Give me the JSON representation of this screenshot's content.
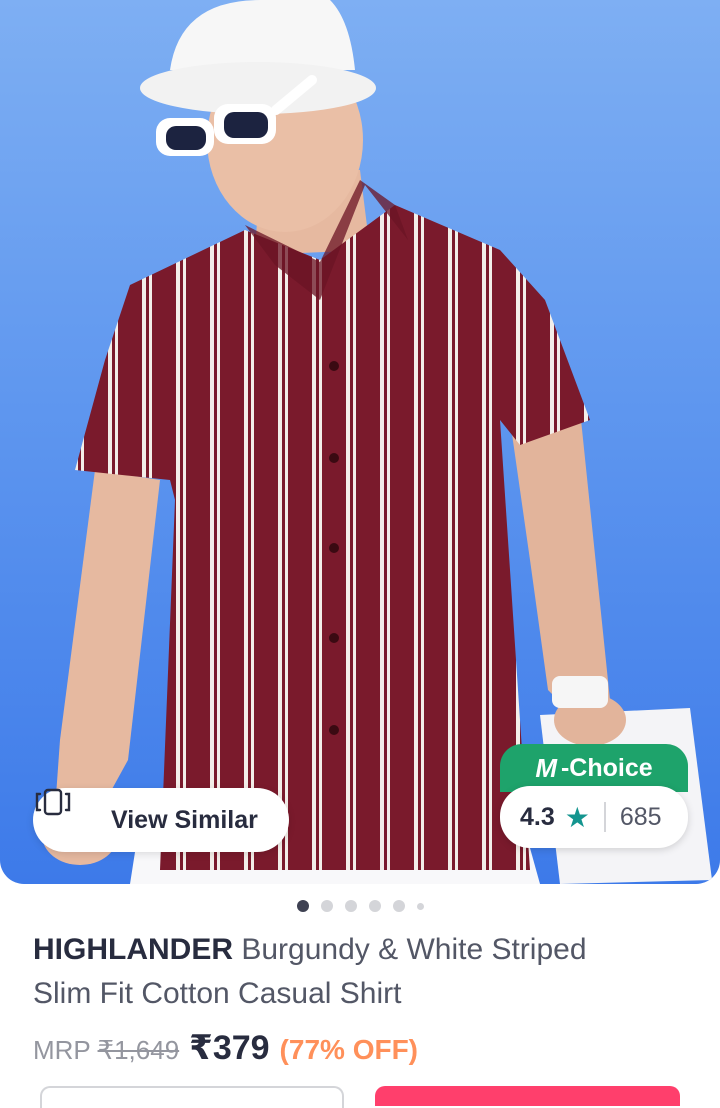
{
  "product": {
    "brand": "HIGHLANDER",
    "name_line1": "Burgundy & White Striped",
    "name_line2": "Slim Fit Cotton Casual Shirt",
    "mrp_label": "MRP",
    "mrp_value": "₹1,649",
    "price": "₹379",
    "discount": "(77% OFF)"
  },
  "gallery": {
    "view_similar_label": "View Similar",
    "badge_label": "-Choice",
    "badge_letter": "M",
    "rating": "4.3",
    "rating_count": "685",
    "image_count": 6,
    "active_index": 0
  },
  "colors": {
    "accent_green": "#1ea36b",
    "star_teal": "#14958f",
    "discount_orange": "#ff905a",
    "shirt_burgundy": "#7a1a2c"
  }
}
